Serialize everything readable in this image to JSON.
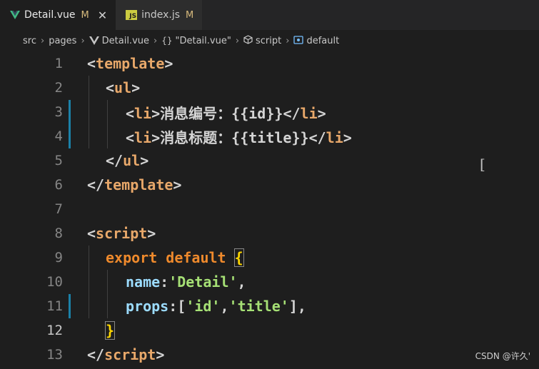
{
  "tabs": [
    {
      "label": "Detail.vue",
      "modified": "M",
      "active": true,
      "icon": "vue-icon"
    },
    {
      "label": "index.js",
      "modified": "M",
      "active": false,
      "icon": "js-icon"
    }
  ],
  "breadcrumb": {
    "items": [
      "src",
      "pages",
      "Detail.vue",
      "\"Detail.vue\"",
      "script",
      "default"
    ],
    "braces": "{}"
  },
  "editor": {
    "current_line": "12",
    "line_numbers": [
      "1",
      "2",
      "3",
      "4",
      "5",
      "6",
      "7",
      "8",
      "9",
      "10",
      "11",
      "12",
      "13"
    ],
    "lines": {
      "l1_open": "<",
      "l1_tag": "template",
      "l1_close": ">",
      "l2_open": "<",
      "l2_tag": "ul",
      "l2_close": ">",
      "l3_a": "<",
      "l3_tag": "li",
      "l3_b": ">",
      "l3_text": "消息编号：{{id}}",
      "l3_c": "</",
      "l3_tag2": "li",
      "l3_d": ">",
      "l4_a": "<",
      "l4_tag": "li",
      "l4_b": ">",
      "l4_text": "消息标题：{{title}}",
      "l4_c": "</",
      "l4_tag2": "li",
      "l4_d": ">",
      "l5_a": "</",
      "l5_tag": "ul",
      "l5_b": ">",
      "l6_a": "</",
      "l6_tag": "template",
      "l6_b": ">",
      "l8_a": "<",
      "l8_tag": "script",
      "l8_b": ">",
      "l9_kw": "export default",
      "l9_brace": "{",
      "l10_prop": "name",
      "l10_colon": ":",
      "l10_str": "'Detail'",
      "l10_comma": ",",
      "l11_prop": "props",
      "l11_colon": ":[",
      "l11_str1": "'id'",
      "l11_comma1": ",",
      "l11_str2": "'title'",
      "l11_end": "],",
      "l12_brace": "}",
      "l13_a": "</",
      "l13_tag": "script",
      "l13_b": ">"
    }
  },
  "watermark": "CSDN @许久'",
  "colors": {
    "background": "#1e1e1e",
    "tag": "#e8a86a",
    "keyword": "#ef8a2c",
    "string": "#a6e075",
    "modified": "#d7ba7d"
  }
}
